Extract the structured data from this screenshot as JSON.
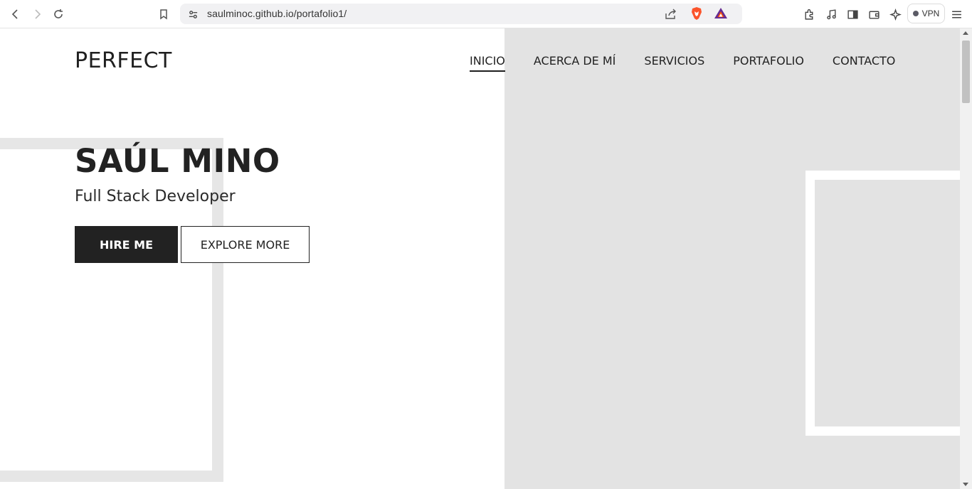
{
  "browser": {
    "url": "saulminoc.github.io/portafolio1/",
    "vpn_label": "VPN"
  },
  "site": {
    "logo_mark": "P",
    "logo_text": "ERFECT",
    "menu": [
      {
        "label": "INICIO",
        "active": true
      },
      {
        "label": "ACERCA DE MÍ"
      },
      {
        "label": "SERVICIOS"
      },
      {
        "label": "PORTAFOLIO"
      },
      {
        "label": "CONTACTO"
      }
    ],
    "hero": {
      "name": "SAÚL MINO",
      "role": "Full Stack Developer",
      "hire_label": "HIRE ME",
      "explore_label": "EXPLORE MORE"
    }
  },
  "colors": {
    "dark": "#222222",
    "panel_gray": "#e3e3e3"
  }
}
